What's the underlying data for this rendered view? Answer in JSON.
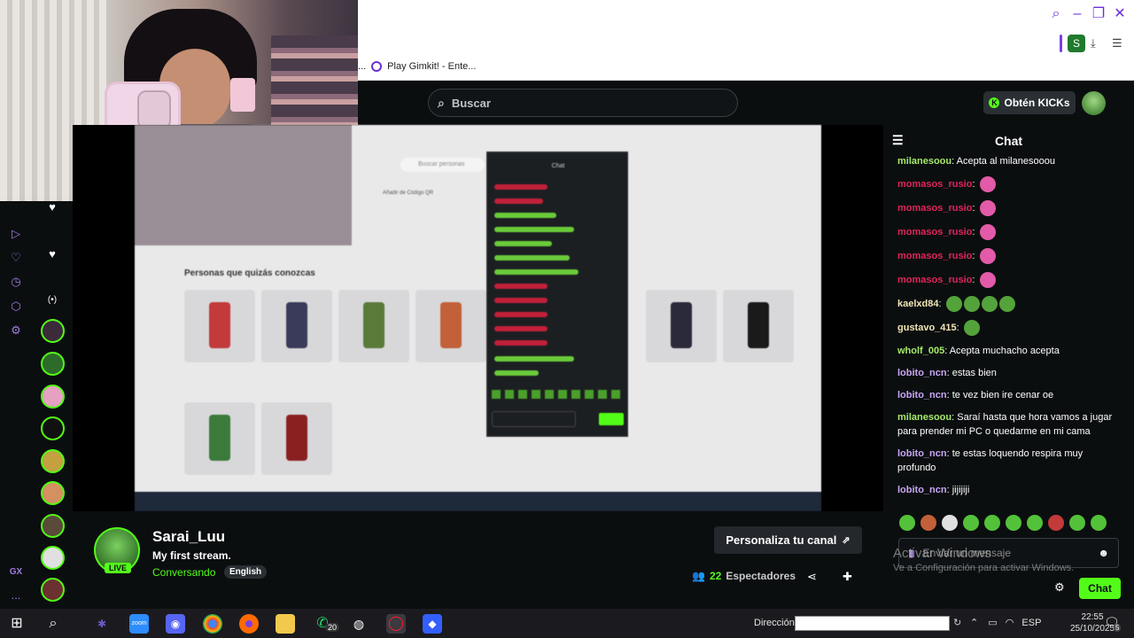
{
  "browser": {
    "tab_label": "Play Gimkit! - Ente...",
    "tab_ellipsis": "...",
    "extension_s": "S"
  },
  "header": {
    "search_placeholder": "Buscar",
    "kicks_label": "Obtén KICKs"
  },
  "stream": {
    "streamer": "Sarai_Luu",
    "title": "My first stream.",
    "category": "Conversando",
    "language": "English",
    "live_label": "LIVE",
    "customize_label": "Personaliza tu canal",
    "viewers_count": "22",
    "viewers_label": "Espectadores"
  },
  "chat": {
    "header": "Chat",
    "messages": [
      {
        "user": "milanesoou",
        "color": "#a5e86b",
        "text": "Acepta al milanesooou"
      },
      {
        "user": "momasos_rusio",
        "color": "#e0245e",
        "text": ""
      },
      {
        "user": "momasos_rusio",
        "color": "#e0245e",
        "text": ""
      },
      {
        "user": "momasos_rusio",
        "color": "#e0245e",
        "text": ""
      },
      {
        "user": "momasos_rusio",
        "color": "#e0245e",
        "text": ""
      },
      {
        "user": "momasos_rusio",
        "color": "#e0245e",
        "text": ""
      },
      {
        "user": "kaelxd84",
        "color": "#f0e6b4",
        "text": ""
      },
      {
        "user": "gustavo_415",
        "color": "#f0e6b4",
        "text": ""
      },
      {
        "user": "wholf_005",
        "color": "#a5e86b",
        "text": "Acepta muchacho acepta"
      },
      {
        "user": "lobito_ncn",
        "color": "#c9a6f5",
        "text": "estas bien"
      },
      {
        "user": "lobito_ncn",
        "color": "#c9a6f5",
        "text": "te vez bien ire cenar oe"
      },
      {
        "user": "milanesoou",
        "color": "#a5e86b",
        "text": "Saraí hasta que hora vamos a jugar para prender mi PC o quedarme en mi cama"
      },
      {
        "user": "lobito_ncn",
        "color": "#c9a6f5",
        "text": "te estas loquendo respira muy profundo"
      },
      {
        "user": "lobito_ncn",
        "color": "#c9a6f5",
        "text": "jijijiji"
      }
    ],
    "input_placeholder": "Enviar un mensaje",
    "send_label": "Chat"
  },
  "watermark": {
    "line1": "Activar Windows",
    "line2": "Ve a Configuración para activar Windows."
  },
  "sidebar": {
    "gx_label": "GX",
    "more_label": "..."
  },
  "video_shot": {
    "section_title": "Personas que quizás conozcas",
    "search_placeholder": "Buscar personas",
    "qr_label": "Añadir de Código QR",
    "chat_label": "Chat"
  },
  "taskbar": {
    "direccion_label": "Dirección",
    "lang": "ESP",
    "time": "22:55",
    "date": "25/10/2025",
    "whatsapp_badge": "20",
    "notif_badge": "5"
  }
}
